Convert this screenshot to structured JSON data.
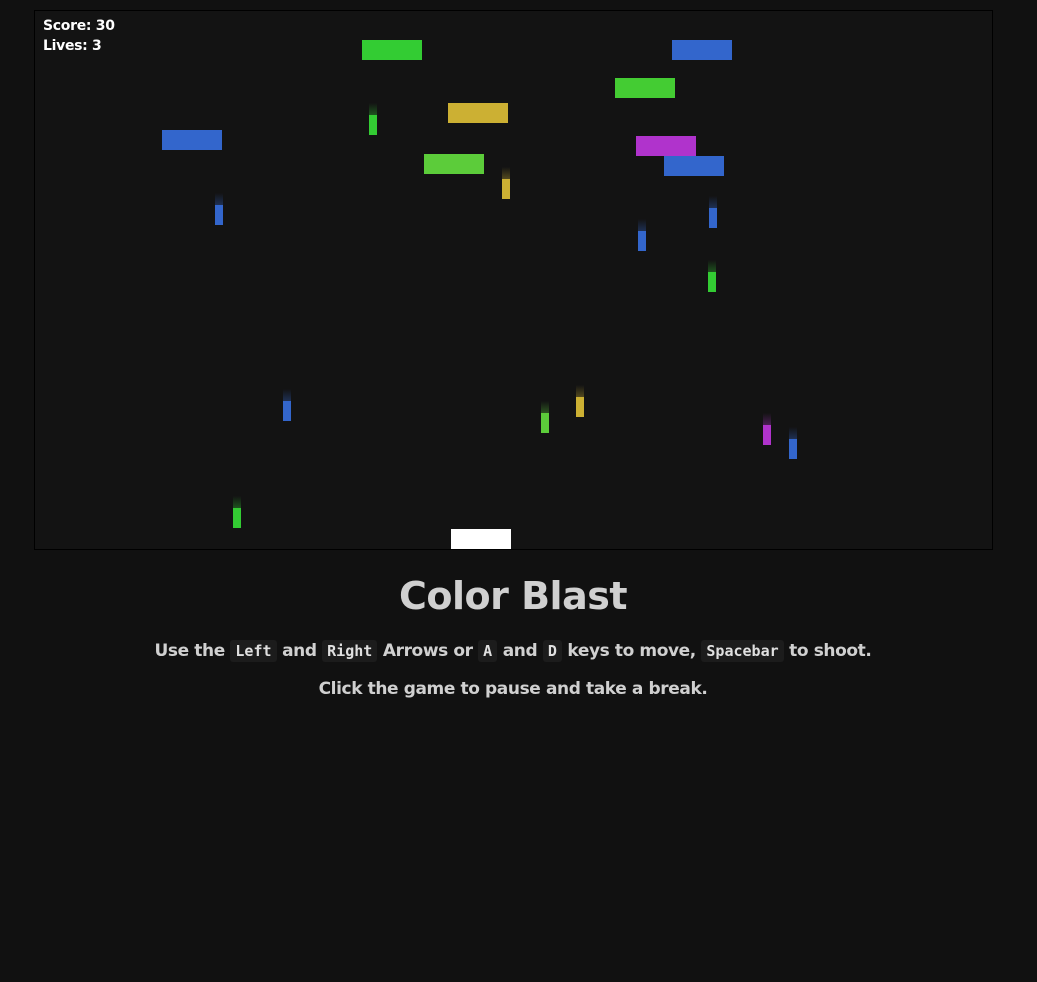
{
  "hud": {
    "score_label": "Score: 30",
    "lives_label": "Lives: 3"
  },
  "title": "Color Blast",
  "instructions": {
    "use_the": "Use the",
    "key_left": "Left",
    "and1": "and",
    "key_right": "Right",
    "arrows_or": "Arrows or",
    "key_a": "A",
    "and2": "and",
    "key_d": "D",
    "keys_to_move": "keys to move,",
    "key_space": "Spacebar",
    "to_shoot": "to shoot.",
    "pause_hint": "Click the game to pause and take a break."
  },
  "colors": {
    "background": "#111111",
    "canvas": "#131313",
    "green": "#33cc33",
    "lime": "#5ccc3a",
    "blue": "#3366cc",
    "yellow": "#ccb033",
    "magenta": "#b033cc",
    "player": "#ffffff"
  }
}
